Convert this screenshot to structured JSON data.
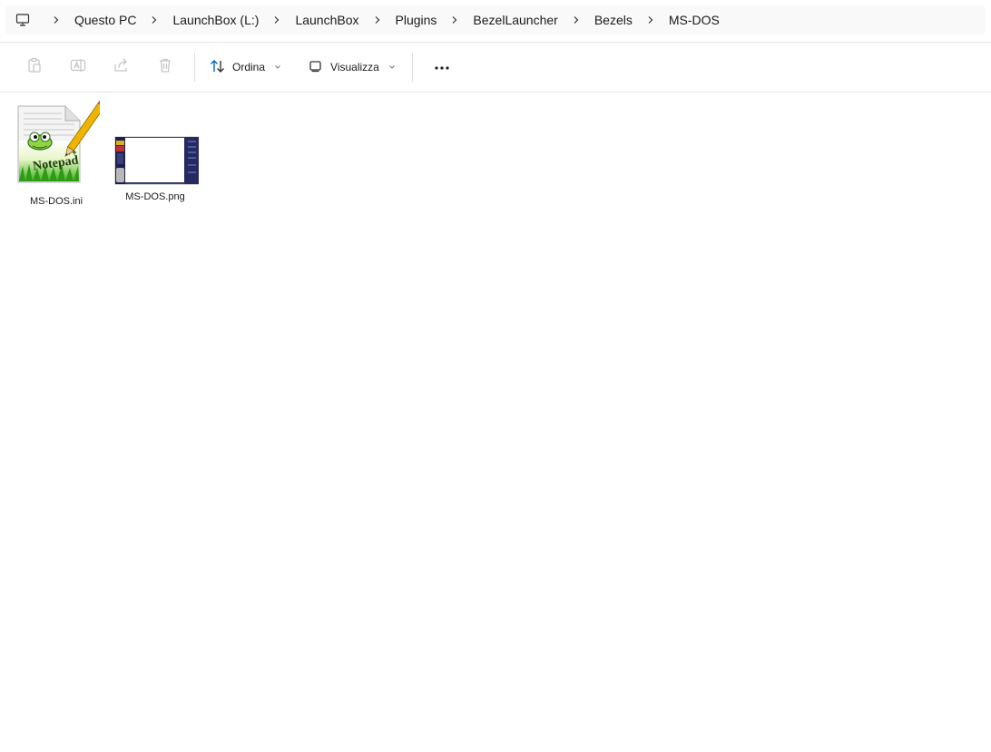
{
  "breadcrumb": {
    "root_icon": "computer-icon",
    "items": [
      "Questo PC",
      "LaunchBox (L:)",
      "LaunchBox",
      "Plugins",
      "BezelLauncher",
      "Bezels",
      "MS-DOS"
    ]
  },
  "toolbar": {
    "icons": [
      "clipboard-icon",
      "rename-icon",
      "share-icon",
      "trash-icon"
    ],
    "sort_label": "Ordina",
    "view_label": "Visualizza",
    "more_icon": "more-icon"
  },
  "files": [
    {
      "name": "MS-DOS.ini",
      "icon": "notepadpp-file-icon"
    },
    {
      "name": "MS-DOS.png",
      "icon": "image-thumbnail"
    }
  ],
  "colors": {
    "accent": "#0067c0",
    "disabled_icon": "#c6c6c6",
    "address_bg": "#f9f9f9"
  }
}
